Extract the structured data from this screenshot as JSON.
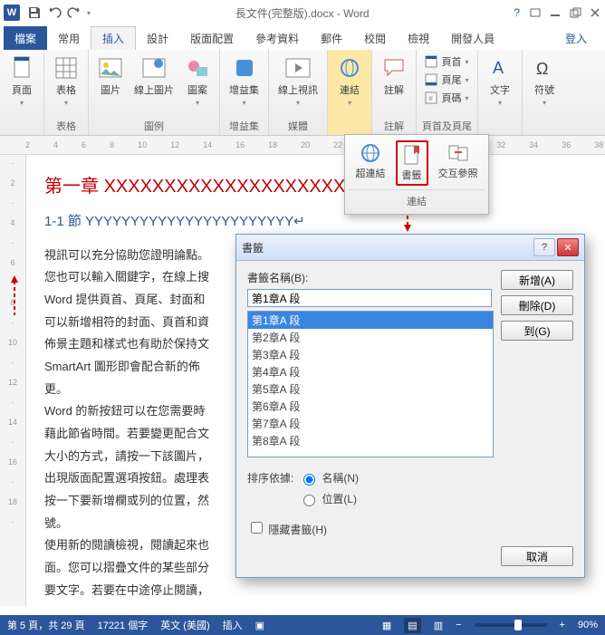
{
  "titlebar": {
    "doc_title": "長文件(完整版).docx - Word"
  },
  "tabs": {
    "file": "檔案",
    "home": "常用",
    "insert": "插入",
    "design": "設計",
    "layout": "版面配置",
    "references": "參考資料",
    "mail": "郵件",
    "review": "校閱",
    "view": "檢視",
    "dev": "開發人員",
    "login": "登入"
  },
  "ribbon": {
    "pages": "頁面",
    "tables": "表格",
    "group_tables": "表格",
    "images": "圖片",
    "online_images": "線上圖片",
    "shapes": "圖案",
    "group_illustrations": "圖例",
    "addins": "增益集",
    "online_video": "線上視訊",
    "group_addins": "增益集",
    "group_media": "媒體",
    "links": "連結",
    "comments": "註解",
    "group_comments": "註解",
    "header": "頁首",
    "footer": "頁尾",
    "page_no": "頁碼",
    "group_hf": "頁首及頁尾",
    "text": "文字",
    "symbols": "符號"
  },
  "links_pop": {
    "hyperlink": "超連結",
    "bookmark": "書籤",
    "crossref": "交互參照",
    "cat": "連結"
  },
  "document": {
    "h1_prefix": "第一章",
    "h1_xxx": "XXXXXXXXXXXXXXXXXXXXXXXXXX",
    "h2": "1-1 節",
    "h2_y": "YYYYYYYYYYYYYYYYYYYYYYY",
    "p1": "視訊可以充分協助您證明論點。",
    "p2": "您也可以輸入關鍵字，在線上搜",
    "p3": "Word 提供頁首、頁尾、封面和",
    "p4": "可以新增相符的封面、頁首和資",
    "p5": "佈景主題和樣式也有助於保持文",
    "p6": "SmartArt 圖形即會配合新的佈",
    "p7": "更。",
    "p8": "Word 的新按鈕可以在您需要時",
    "p9": "藉此節省時間。若要變更配合文",
    "p10": "大小的方式，請按一下該圖片，",
    "p11": "出現版面配置選項按鈕。處理表",
    "p12": "按一下要新增欄或列的位置，然",
    "p13": "號。",
    "p14": "使用新的閱讀檢視，閱讀起來也",
    "p15": "面。您可以摺疊文件的某些部分",
    "p16": "要文字。若要在中途停止閱讀，"
  },
  "dialog": {
    "title": "書籤",
    "name_label": "書籤名稱(B):",
    "name_value": "第1章A 段",
    "items": [
      "第1章A 段",
      "第2章A 段",
      "第3章A 段",
      "第4章A 段",
      "第5章A 段",
      "第6章A 段",
      "第7章A 段",
      "第8章A 段"
    ],
    "sort_label": "排序依據:",
    "sort_name": "名稱(N)",
    "sort_loc": "位置(L)",
    "hide": "隱藏書籤(H)",
    "add": "新增(A)",
    "delete": "刪除(D)",
    "go": "到(G)",
    "cancel": "取消"
  },
  "status": {
    "page": "第 5 頁，共 29 頁",
    "words": "17221 個字",
    "lang": "英文 (美國)",
    "mode": "插入",
    "zoom": "90%"
  }
}
